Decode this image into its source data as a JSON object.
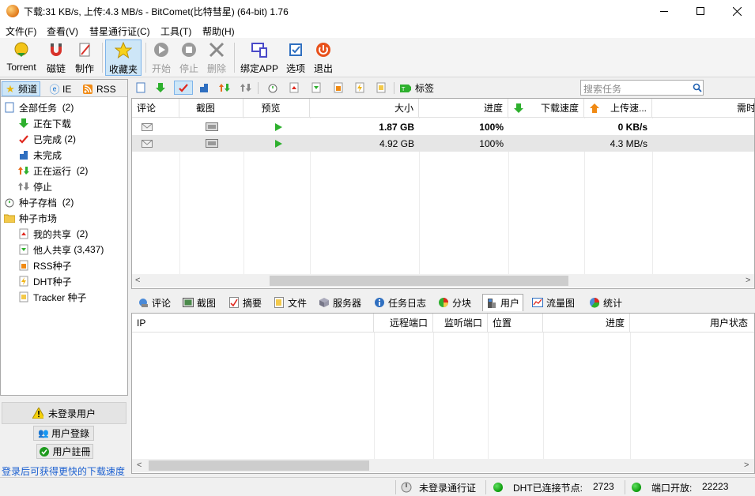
{
  "window": {
    "title": "下载:31 KB/s, 上传:4.3 MB/s - BitComet(比特彗星) (64-bit) 1.76",
    "controls": [
      "minimize",
      "maximize",
      "close"
    ]
  },
  "menu": [
    "文件(F)",
    "查看(V)",
    "彗星通行证(C)",
    "工具(T)",
    "帮助(H)"
  ],
  "toolbar": {
    "items": [
      {
        "label": "Torrent",
        "icon": "torrent-icon"
      },
      {
        "label": "磁链",
        "icon": "magnet-icon"
      },
      {
        "label": "制作",
        "icon": "make-icon"
      },
      {
        "label": "收藏夹",
        "icon": "favorites-icon"
      },
      {
        "label": "开始",
        "icon": "start-icon"
      },
      {
        "label": "停止",
        "icon": "stop-icon"
      },
      {
        "label": "删除",
        "icon": "delete-icon"
      },
      {
        "label": "绑定APP",
        "icon": "bind-app-icon"
      },
      {
        "label": "选项",
        "icon": "options-icon"
      },
      {
        "label": "退出",
        "icon": "exit-icon"
      }
    ]
  },
  "left_tabs": [
    {
      "label": "频道"
    },
    {
      "label": "IE"
    },
    {
      "label": "RSS"
    }
  ],
  "tree": [
    {
      "label": "全部任务",
      "count": "(2)"
    },
    {
      "label": "正在下载",
      "count": ""
    },
    {
      "label": "已完成",
      "count": "(2)"
    },
    {
      "label": "未完成",
      "count": ""
    },
    {
      "label": "正在运行",
      "count": "(2)"
    },
    {
      "label": "停止",
      "count": ""
    },
    {
      "label": "种子存档",
      "count": "(2)"
    },
    {
      "label": "种子市场",
      "count": ""
    },
    {
      "label": "我的共享",
      "count": "(2)"
    },
    {
      "label": "他人共享",
      "count": "(3,437)"
    },
    {
      "label": "RSS种子",
      "count": ""
    },
    {
      "label": "DHT种子",
      "count": ""
    },
    {
      "label": "Tracker 种子",
      "count": ""
    }
  ],
  "login": {
    "status": "未登录用户",
    "login_btn": "用户登錄",
    "register_btn": "用户註冊",
    "promo": "登录后可获得更快的下载速度"
  },
  "task_toolbar": {
    "tag_label": "标签",
    "search_placeholder": "搜索任务"
  },
  "task_table": {
    "headers": [
      "评论",
      "截图",
      "预览",
      "大小",
      "进度",
      "下载速度",
      "上传速...",
      "需时"
    ],
    "rows": [
      {
        "size": "1.87 GB",
        "progress": "100%",
        "down": "",
        "up": "0 KB/s",
        "bold": true
      },
      {
        "size": "4.92 GB",
        "progress": "100%",
        "down": "",
        "up": "4.3 MB/s",
        "bold": false
      }
    ]
  },
  "bottom_tabs": [
    "评论",
    "截图",
    "摘要",
    "文件",
    "服务器",
    "任务日志",
    "分块",
    "用户",
    "流量图",
    "统计"
  ],
  "peer_table": {
    "headers": [
      "IP",
      "远程端口",
      "监听端口",
      "位置",
      "进度",
      "用户状态"
    ]
  },
  "status": {
    "passport": "未登录通行证",
    "dht_label": "DHT已连接节点:",
    "dht_value": "2723",
    "port_label": "端口开放:",
    "port_value": "22223"
  }
}
